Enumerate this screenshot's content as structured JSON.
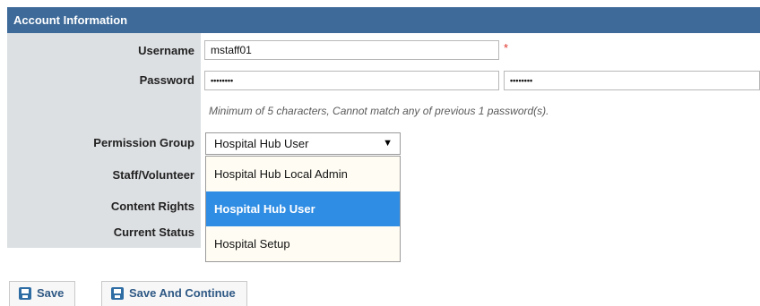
{
  "section": {
    "title": "Account Information"
  },
  "fields": {
    "username": {
      "label": "Username",
      "value": "mstaff01",
      "required_mark": "*"
    },
    "password": {
      "label": "Password",
      "value": "••••••••",
      "confirm_value": "••••••••"
    },
    "password_hint": "Minimum of 5 characters, Cannot match any of previous 1 password(s).",
    "permission_group": {
      "label": "Permission Group",
      "selected": "Hospital Hub User",
      "arrow": "▼",
      "options": [
        "Hospital Hub Local Admin",
        "Hospital Hub User",
        "Hospital Setup"
      ]
    },
    "staff_volunteer": {
      "label": "Staff/Volunteer"
    },
    "content_rights": {
      "label": "Content Rights"
    },
    "current_status": {
      "label": "Current Status"
    }
  },
  "buttons": {
    "save": "Save",
    "save_continue": "Save And Continue"
  },
  "colors": {
    "header": "#3d6a99",
    "label_panel": "#dde0e3",
    "selected_option": "#2f8de4",
    "required": "#e0322c",
    "button_text": "#2e5884"
  }
}
